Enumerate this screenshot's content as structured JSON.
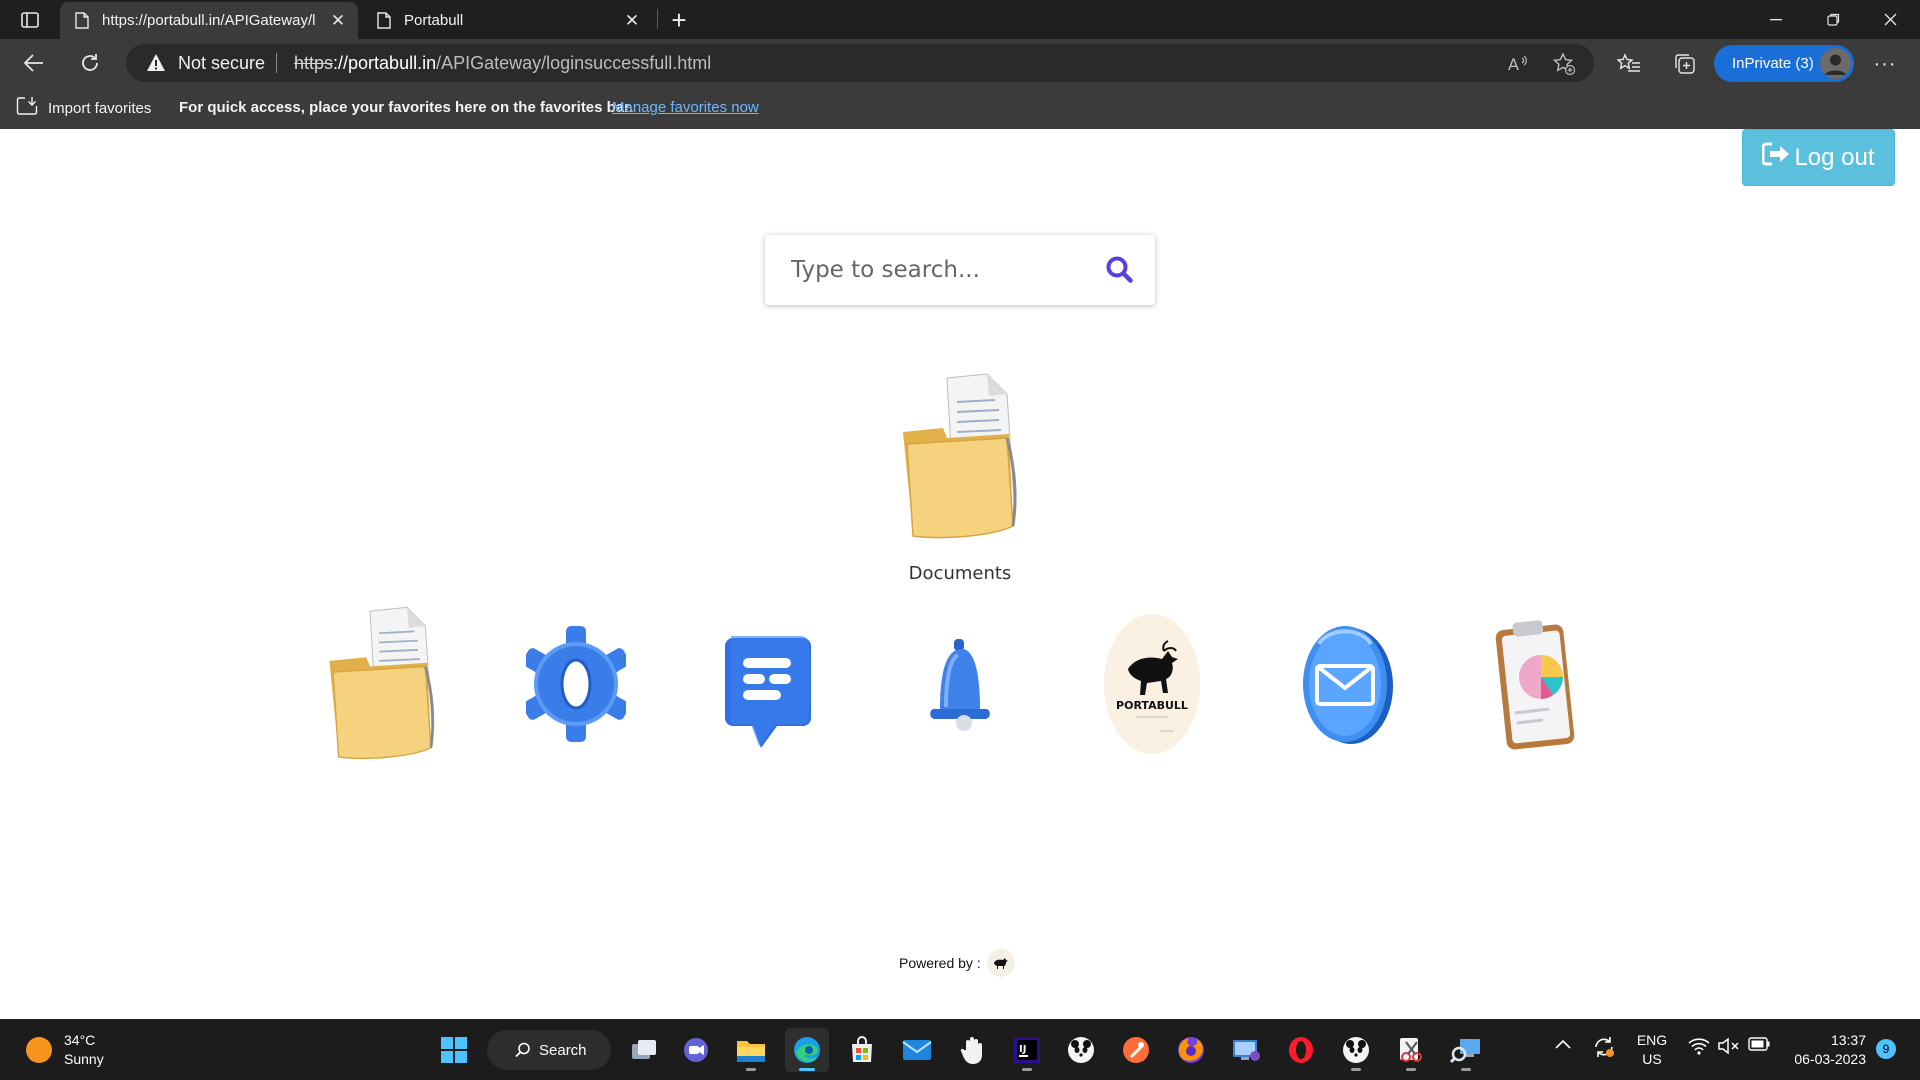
{
  "browser": {
    "tabs": [
      {
        "title": "https://portabull.in/APIGateway/l",
        "active": true
      },
      {
        "title": "Portabull",
        "active": false
      }
    ],
    "address": {
      "security_label": "Not secure",
      "url_scheme": "https",
      "url_host": "://portabull.in",
      "url_path": "/APIGateway/loginsuccessfull.html"
    },
    "inprivate_label": "InPrivate (3)",
    "favorites_bar": {
      "import_label": "Import favorites",
      "message": "For quick access, place your favorites here on the favorites bar.",
      "link": "Manage favorites now"
    }
  },
  "page": {
    "logout_label": "Log out",
    "search": {
      "placeholder": "Type to search..."
    },
    "featured": {
      "label": "Documents",
      "icon": "folder-documents-icon"
    },
    "apps": [
      {
        "name": "documents",
        "icon": "folder-documents-icon"
      },
      {
        "name": "settings",
        "icon": "gear-icon"
      },
      {
        "name": "messages",
        "icon": "chat-bubble-icon"
      },
      {
        "name": "notifications",
        "icon": "bell-icon"
      },
      {
        "name": "portabull",
        "icon": "portabull-logo-icon",
        "logo_text": "PORTABULL"
      },
      {
        "name": "mail",
        "icon": "mail-icon"
      },
      {
        "name": "reports",
        "icon": "clipboard-chart-icon"
      }
    ],
    "powered_by": "Powered by :"
  },
  "taskbar": {
    "weather": {
      "temp": "34°C",
      "condition": "Sunny"
    },
    "search_label": "Search",
    "language": {
      "line1": "ENG",
      "line2": "US"
    },
    "clock": {
      "time": "13:37",
      "date": "06-03-2023"
    },
    "notification_count": "9"
  },
  "colors": {
    "logout_button": "#5bc0de",
    "search_icon": "#5b3ee0",
    "inprivate": "#1a6ed8"
  }
}
